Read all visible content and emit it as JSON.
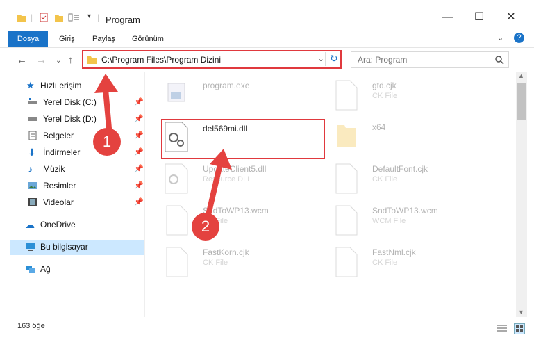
{
  "window": {
    "title": "Program"
  },
  "ribbon": {
    "tabs": [
      "Dosya",
      "Giriş",
      "Paylaş",
      "Görünüm"
    ]
  },
  "address": {
    "path": "C:\\Program Files\\Program Dizini"
  },
  "search": {
    "placeholder": "Ara: Program"
  },
  "sidebar": {
    "quick_access": "Hızlı erişim",
    "items": [
      "Yerel Disk (C:)",
      "Yerel Disk (D:)",
      "Belgeler",
      "İndirmeler",
      "Müzik",
      "Resimler",
      "Videolar"
    ],
    "onedrive": "OneDrive",
    "this_pc": "Bu bilgisayar",
    "network": "Ağ"
  },
  "files": [
    {
      "name": "program.exe",
      "type": ""
    },
    {
      "name": "gtd.cjk",
      "type": "CK File"
    },
    {
      "name": "del569mi.dll",
      "type": ""
    },
    {
      "name": "x64",
      "type": ""
    },
    {
      "name": "UpdateClient5.dll",
      "type": "Resource DLL"
    },
    {
      "name": "DefaultFont.cjk",
      "type": "CK File"
    },
    {
      "name": "SndToWP13.wcm",
      "type": "CK File"
    },
    {
      "name": "SndToWP13.wcm",
      "type": "WCM File"
    },
    {
      "name": "FastKorn.cjk",
      "type": "CK File"
    },
    {
      "name": "FastNml.cjk",
      "type": "CK File"
    }
  ],
  "status": {
    "count": "163 öğe"
  },
  "annotations": {
    "step1": "1",
    "step2": "2"
  },
  "colors": {
    "accent": "#1a73c8",
    "highlight": "#e0393e",
    "selection": "#cce8ff"
  }
}
